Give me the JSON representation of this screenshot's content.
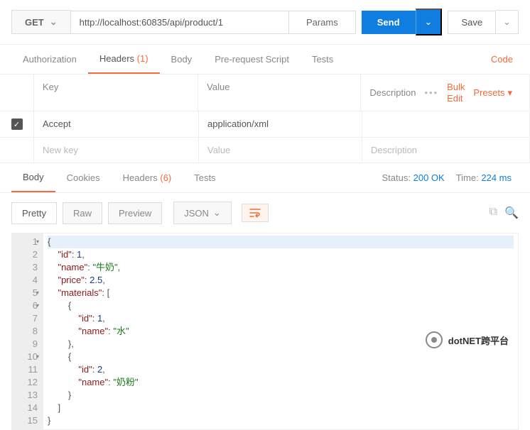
{
  "request": {
    "method": "GET",
    "url": "http://localhost:60835/api/product/1",
    "params_btn": "Params",
    "send_btn": "Send",
    "save_btn": "Save"
  },
  "tabs": {
    "auth": "Authorization",
    "headers": "Headers",
    "headers_count": "(1)",
    "body": "Body",
    "prereq": "Pre-request Script",
    "tests": "Tests",
    "code": "Code"
  },
  "header_table": {
    "key_label": "Key",
    "value_label": "Value",
    "desc_label": "Description",
    "bulk_edit": "Bulk Edit",
    "presets": "Presets",
    "row_key": "Accept",
    "row_value": "application/xml",
    "new_key": "New key",
    "new_value": "Value",
    "new_desc": "Description"
  },
  "response": {
    "body_tab": "Body",
    "cookies_tab": "Cookies",
    "headers_tab": "Headers",
    "headers_count": "(6)",
    "tests_tab": "Tests",
    "status_label": "Status:",
    "status_value": "200 OK",
    "time_label": "Time:",
    "time_value": "224 ms"
  },
  "viewbar": {
    "pretty": "Pretty",
    "raw": "Raw",
    "preview": "Preview",
    "format": "JSON"
  },
  "body_data": {
    "id": 1,
    "name": "牛奶",
    "price": 2.5,
    "materials": [
      {
        "id": 1,
        "name": "水"
      },
      {
        "id": 2,
        "name": "奶粉"
      }
    ]
  },
  "code_lines": [
    {
      "n": 1,
      "arr": "▾",
      "t": [
        {
          "c": "p",
          "v": "{"
        }
      ]
    },
    {
      "n": 2,
      "t": [
        {
          "c": "p",
          "v": "    "
        },
        {
          "c": "k",
          "v": "\"id\""
        },
        {
          "c": "p",
          "v": ": "
        },
        {
          "c": "n",
          "v": "1"
        },
        {
          "c": "p",
          "v": ","
        }
      ]
    },
    {
      "n": 3,
      "t": [
        {
          "c": "p",
          "v": "    "
        },
        {
          "c": "k",
          "v": "\"name\""
        },
        {
          "c": "p",
          "v": ": "
        },
        {
          "c": "s",
          "v": "\"牛奶\""
        },
        {
          "c": "p",
          "v": ","
        }
      ]
    },
    {
      "n": 4,
      "t": [
        {
          "c": "p",
          "v": "    "
        },
        {
          "c": "k",
          "v": "\"price\""
        },
        {
          "c": "p",
          "v": ": "
        },
        {
          "c": "n",
          "v": "2.5"
        },
        {
          "c": "p",
          "v": ","
        }
      ]
    },
    {
      "n": 5,
      "arr": "▾",
      "t": [
        {
          "c": "p",
          "v": "    "
        },
        {
          "c": "k",
          "v": "\"materials\""
        },
        {
          "c": "p",
          "v": ": ["
        }
      ]
    },
    {
      "n": 6,
      "arr": "▾",
      "t": [
        {
          "c": "p",
          "v": "        {"
        }
      ]
    },
    {
      "n": 7,
      "t": [
        {
          "c": "p",
          "v": "            "
        },
        {
          "c": "k",
          "v": "\"id\""
        },
        {
          "c": "p",
          "v": ": "
        },
        {
          "c": "n",
          "v": "1"
        },
        {
          "c": "p",
          "v": ","
        }
      ]
    },
    {
      "n": 8,
      "t": [
        {
          "c": "p",
          "v": "            "
        },
        {
          "c": "k",
          "v": "\"name\""
        },
        {
          "c": "p",
          "v": ": "
        },
        {
          "c": "s",
          "v": "\"水\""
        }
      ]
    },
    {
      "n": 9,
      "t": [
        {
          "c": "p",
          "v": "        },"
        }
      ]
    },
    {
      "n": 10,
      "arr": "▾",
      "t": [
        {
          "c": "p",
          "v": "        {"
        }
      ]
    },
    {
      "n": 11,
      "t": [
        {
          "c": "p",
          "v": "            "
        },
        {
          "c": "k",
          "v": "\"id\""
        },
        {
          "c": "p",
          "v": ": "
        },
        {
          "c": "n",
          "v": "2"
        },
        {
          "c": "p",
          "v": ","
        }
      ]
    },
    {
      "n": 12,
      "t": [
        {
          "c": "p",
          "v": "            "
        },
        {
          "c": "k",
          "v": "\"name\""
        },
        {
          "c": "p",
          "v": ": "
        },
        {
          "c": "s",
          "v": "\"奶粉\""
        }
      ]
    },
    {
      "n": 13,
      "t": [
        {
          "c": "p",
          "v": "        }"
        }
      ]
    },
    {
      "n": 14,
      "t": [
        {
          "c": "p",
          "v": "    ]"
        }
      ]
    },
    {
      "n": 15,
      "t": [
        {
          "c": "p",
          "v": "}"
        }
      ]
    }
  ],
  "watermark": "dotNET跨平台"
}
